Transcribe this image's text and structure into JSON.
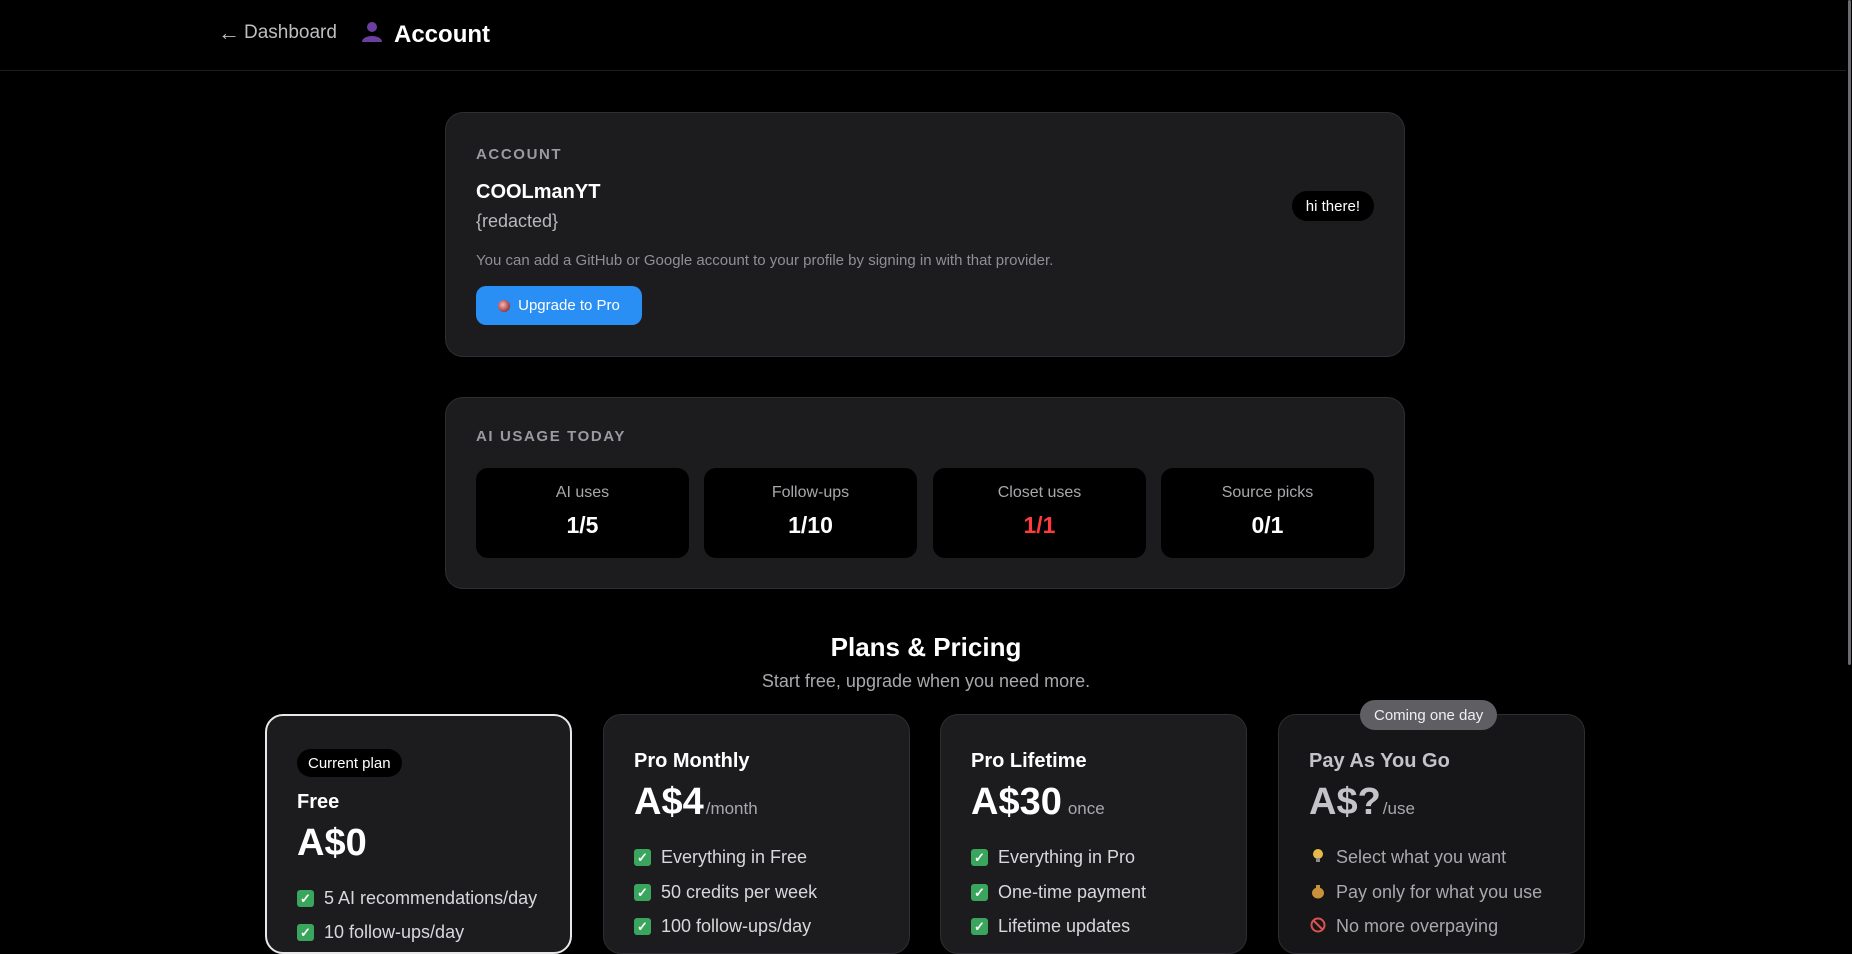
{
  "header": {
    "back_label": "Dashboard",
    "back_arrow": "←",
    "title": "Account",
    "title_icon": "user-silhouette-icon"
  },
  "account": {
    "section_label": "ACCOUNT",
    "username": "COOLmanYT",
    "email": "{redacted}",
    "hint": "You can add a GitHub or Google account to your profile by signing in with that provider.",
    "upgrade_label": "Upgrade to Pro",
    "greeting_pill": "hi there!"
  },
  "usage": {
    "section_label": "AI USAGE TODAY",
    "stats": [
      {
        "label": "AI uses",
        "value": "1/5",
        "color": "#ffffff"
      },
      {
        "label": "Follow-ups",
        "value": "1/10",
        "color": "#ffffff"
      },
      {
        "label": "Closet uses",
        "value": "1/1",
        "color": "#ff3b3b"
      },
      {
        "label": "Source picks",
        "value": "0/1",
        "color": "#ffffff"
      }
    ]
  },
  "plans": {
    "title": "Plans & Pricing",
    "subtitle": "Start free, upgrade when you need more.",
    "coming_badge": "Coming one day",
    "items": [
      {
        "badge": "Current plan",
        "name": "Free",
        "price": "A$0",
        "period": "",
        "features": [
          "5 AI recommendations/day",
          "10 follow-ups/day"
        ]
      },
      {
        "name": "Pro Monthly",
        "price": "A$4",
        "period": "/month",
        "features": [
          "Everything in Free",
          "50 credits per week",
          "100 follow-ups/day"
        ]
      },
      {
        "name": "Pro Lifetime",
        "price": "A$30",
        "period": "once",
        "features": [
          "Everything in Pro",
          "One-time payment",
          "Lifetime updates"
        ]
      },
      {
        "name": "Pay As You Go",
        "price": "A$?",
        "period": "/use",
        "features": [
          "Select what you want",
          "Pay only for what you use",
          "No more overpaying"
        ],
        "feature_icons": [
          "lightbulb-icon",
          "money-bag-icon",
          "prohibited-icon"
        ]
      }
    ]
  },
  "colors": {
    "accent": "#2a8ff5",
    "check": "#3aa55d",
    "warning": "#ff3b3b",
    "card_bg": "#1c1c1f"
  }
}
